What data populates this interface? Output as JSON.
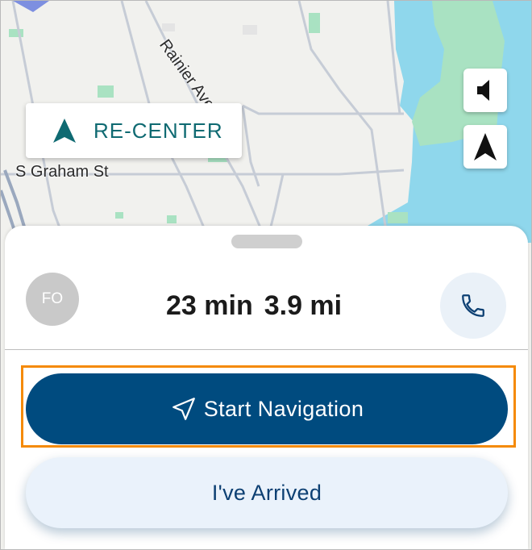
{
  "map": {
    "streets": [
      "Rainier Ave S",
      "S Graham St"
    ],
    "recenter_label": "RE-CENTER",
    "buttons": [
      "speaker-icon",
      "north-arrow-icon"
    ]
  },
  "sheet": {
    "avatar_initials": "FO",
    "eta_time": "23 min",
    "eta_distance": "3.9 mi",
    "call_icon": "phone-icon"
  },
  "actions": {
    "start_label": "Start Navigation",
    "arrived_label": "I've Arrived"
  },
  "colors": {
    "primary": "#004b7f",
    "accent_teal": "#0f6a72",
    "highlight": "#f58a07",
    "water": "#8fd7ec",
    "park": "#a9e2c2"
  }
}
